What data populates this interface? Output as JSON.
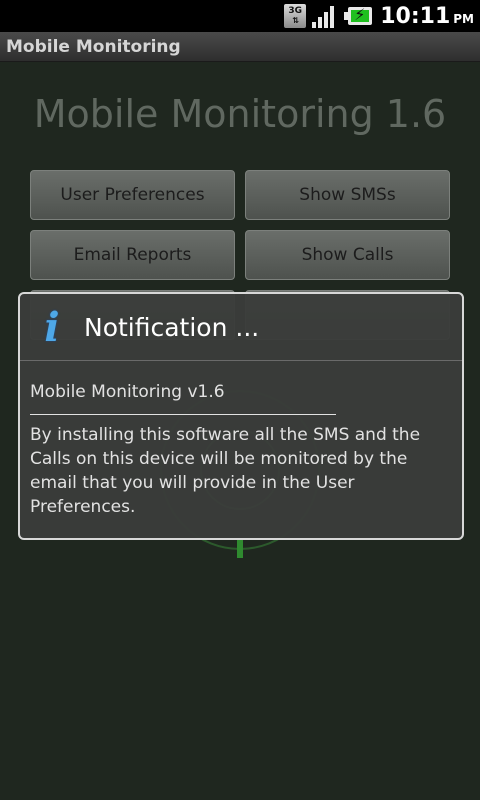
{
  "status_bar": {
    "network_label": "3G",
    "time": "10:11",
    "ampm": "PM",
    "icons": [
      "network-3g-icon",
      "signal-strength-icon",
      "battery-charging-icon"
    ]
  },
  "title_bar": {
    "title": "Mobile Monitoring"
  },
  "main": {
    "heading": "Mobile Monitoring  1.6",
    "buttons": {
      "user_preferences": "User Preferences",
      "show_smss": "Show SMSs",
      "email_reports": "Email Reports",
      "show_calls": "Show Calls"
    }
  },
  "dialog": {
    "title": "Notification ...",
    "icon": "info-icon",
    "version_line": "Mobile Monitoring v1.6",
    "message": "By installing this software all the SMS and the Calls on this device will be monitored by the email that you will provide in the User Preferences."
  },
  "colors": {
    "dialog_border": "#d8d8d8",
    "info_icon": "#4ea8e8",
    "battery_fill": "#1fbf1f"
  }
}
